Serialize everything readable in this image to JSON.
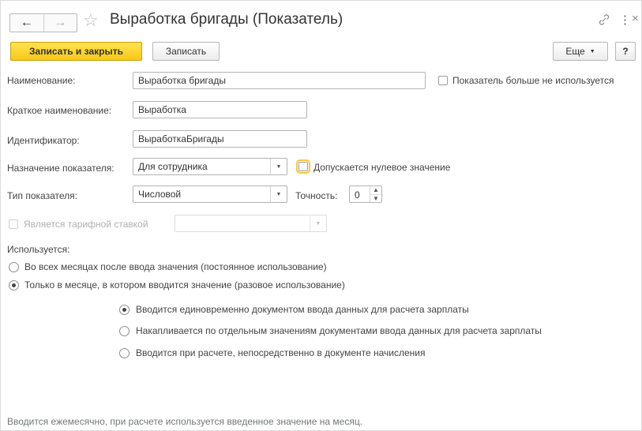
{
  "header": {
    "back_glyph": "←",
    "forward_glyph": "→",
    "favorite_glyph": "☆",
    "title": "Выработка бригады (Показатель)",
    "link_glyph": "🔗",
    "more_glyph": "⋮",
    "close_glyph": "×"
  },
  "toolbar": {
    "save_close_label": "Записать и закрыть",
    "save_label": "Записать",
    "more_label": "Еще",
    "help_label": "?"
  },
  "form": {
    "name_label": "Наименование:",
    "name_value": "Выработка бригады",
    "unused_label": "Показатель больше не используется",
    "short_name_label": "Краткое наименование:",
    "short_name_value": "Выработка",
    "identifier_label": "Идентификатор:",
    "identifier_value": "ВыработкаБригады",
    "purpose_label": "Назначение показателя:",
    "purpose_value": "Для сотрудника",
    "zero_allowed_label": "Допускается нулевое значение",
    "type_label": "Тип показателя:",
    "type_value": "Числовой",
    "precision_label": "Точность:",
    "precision_value": "0",
    "tariff_label": "Является тарифной ставкой",
    "tariff_value": ""
  },
  "usage": {
    "heading": "Используется:",
    "option_all_months": "Во всех месяцах после ввода значения (постоянное использование)",
    "option_one_month": "Только в месяце, в котором вводится значение (разовое использование)",
    "sub_option_once": "Вводится единовременно документом ввода данных для расчета зарплаты",
    "sub_option_accumulated": "Накапливается по отдельным значениям документами ввода данных для расчета зарплаты",
    "sub_option_calc": "Вводится при расчете, непосредственно в документе начисления"
  },
  "footnote": "Вводится ежемесячно, при расчете используется введенное значение на месяц."
}
